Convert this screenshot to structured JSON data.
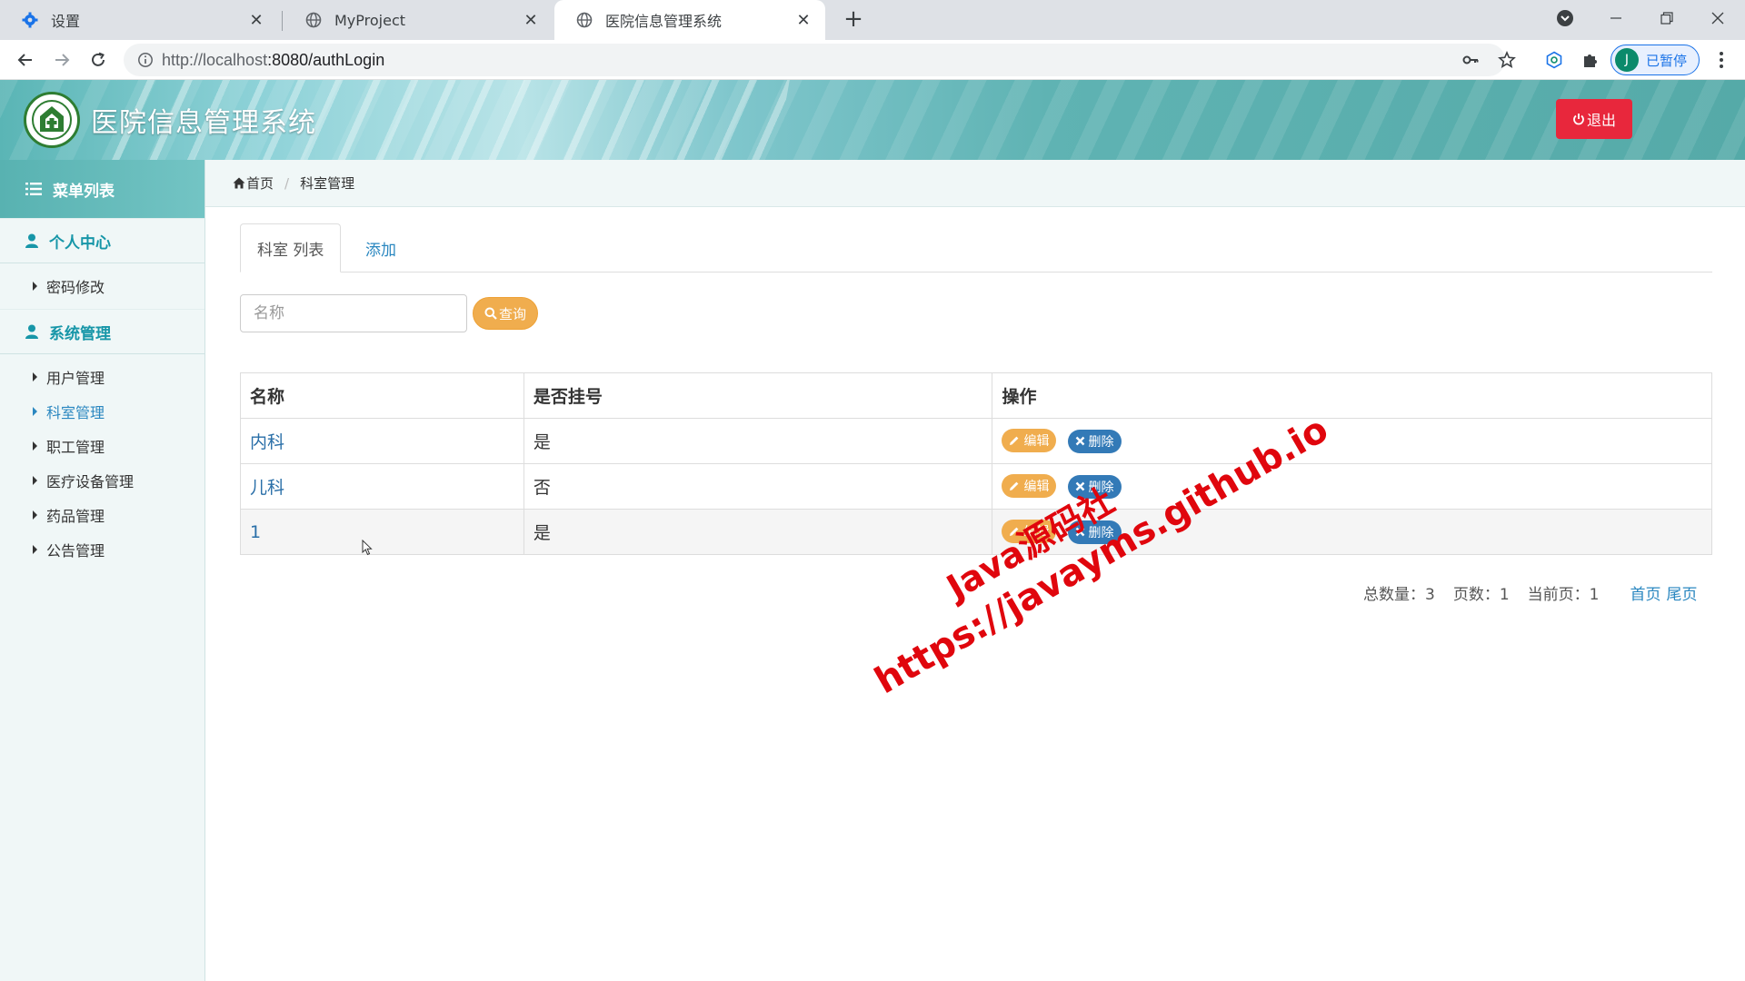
{
  "browser": {
    "tabs": [
      {
        "label": "设置",
        "icon": "gear-icon"
      },
      {
        "label": "MyProject",
        "icon": "globe-icon"
      },
      {
        "label": "医院信息管理系统",
        "icon": "globe-icon",
        "active": true
      }
    ],
    "url_host": "http://localhost",
    "url_rest": ":8080/authLogin",
    "profile_initial": "J",
    "profile_label": "已暂停"
  },
  "header": {
    "title": "医院信息管理系统",
    "logout_label": "退出",
    "accent": "#e8273c"
  },
  "sidebar": {
    "menu_title": "菜单列表",
    "groups": [
      {
        "label": "个人中心",
        "items": [
          "密码修改"
        ]
      },
      {
        "label": "系统管理",
        "items": [
          "用户管理",
          "科室管理",
          "职工管理",
          "医疗设备管理",
          "药品管理",
          "公告管理"
        ]
      }
    ],
    "active_item": "科室管理"
  },
  "breadcrumb": {
    "home": "首页",
    "current": "科室管理"
  },
  "page_tabs": {
    "list": "科室 列表",
    "add": "添加"
  },
  "search": {
    "placeholder": "名称",
    "button": "查询"
  },
  "table": {
    "headers": [
      "名称",
      "是否挂号",
      "操作"
    ],
    "rows": [
      {
        "name": "内科",
        "registered": "是"
      },
      {
        "name": "儿科",
        "registered": "否"
      },
      {
        "name": "1",
        "registered": "是"
      }
    ],
    "edit_label": "编辑",
    "delete_label": "删除"
  },
  "pager": {
    "total": "总数量：3",
    "pages": "页数：1",
    "current": "当前页：1",
    "first": "首页",
    "last": "尾页"
  },
  "watermark": {
    "line1": "Java源码社",
    "line2": "https://javayms.github.io"
  }
}
